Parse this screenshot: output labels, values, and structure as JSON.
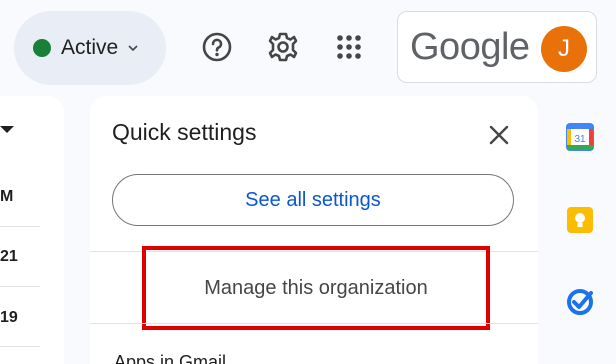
{
  "status": {
    "label": "Active",
    "color": "#188038"
  },
  "header": {
    "help_icon": "help-circle-icon",
    "settings_icon": "gear-icon",
    "apps_icon": "apps-grid-icon",
    "logo_text": "Google",
    "avatar_initial": "J",
    "avatar_color": "#e8710a"
  },
  "mail_list": {
    "rows": [
      "M",
      "21",
      "19"
    ]
  },
  "quick_settings": {
    "title": "Quick settings",
    "see_all_label": "See all settings",
    "manage_label": "Manage this organization",
    "section_label": "Apps in Gmail",
    "highlight_color": "#e00000"
  },
  "side_panel": {
    "calendar_label": "31",
    "icons": [
      "calendar-icon",
      "keep-icon",
      "tasks-icon"
    ]
  }
}
